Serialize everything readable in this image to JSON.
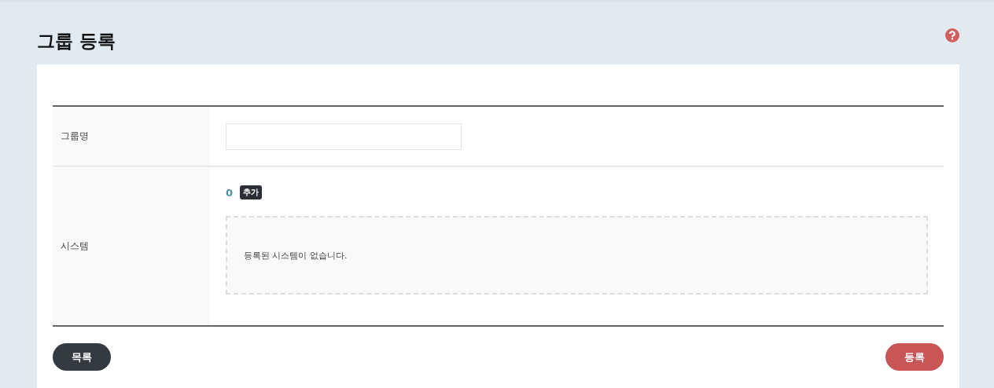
{
  "page_title": "그룹 등록",
  "form": {
    "rows": [
      {
        "kind": "input",
        "label": "그룹명"
      },
      {
        "kind": "list",
        "label": "시스템",
        "count": "0",
        "add_button": "추가",
        "empty_message": "등록된 시스템이 없습니다."
      }
    ]
  },
  "buttons": {
    "left": "목록",
    "right": "등록"
  }
}
